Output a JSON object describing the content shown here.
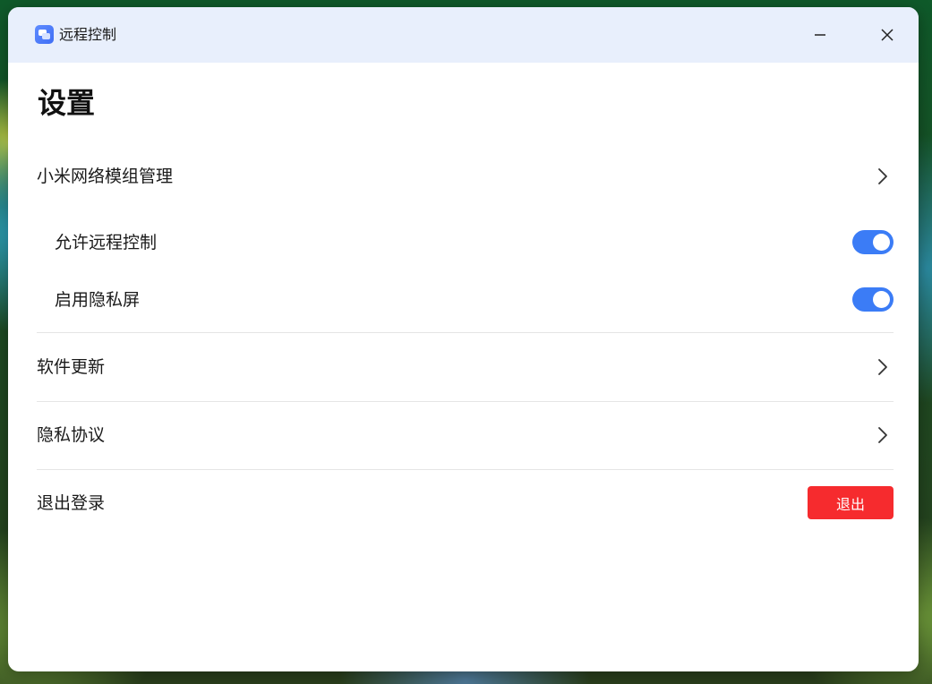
{
  "window": {
    "title": "远程控制",
    "app_icon": "remote-control-app-icon",
    "minimize_icon": "minimize-icon",
    "close_icon": "close-icon"
  },
  "page": {
    "title": "设置"
  },
  "settings": {
    "network_module": {
      "label": "小米网络模组管理",
      "icon": "chevron-right-icon"
    },
    "allow_remote_control": {
      "label": "允许远程控制",
      "enabled": true
    },
    "privacy_screen": {
      "label": "启用隐私屏",
      "enabled": true
    },
    "software_update": {
      "label": "软件更新",
      "icon": "chevron-right-icon"
    },
    "privacy_policy": {
      "label": "隐私协议",
      "icon": "chevron-right-icon"
    },
    "logout": {
      "label": "退出登录",
      "button_label": "退出"
    }
  },
  "colors": {
    "titlebar_bg": "#e8effc",
    "accent": "#3b7cf6",
    "danger": "#f62b2e"
  }
}
